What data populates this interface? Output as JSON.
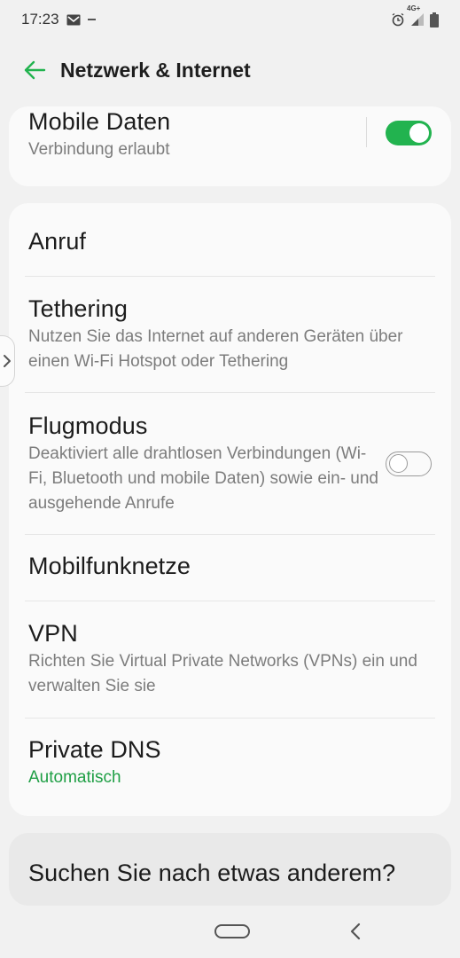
{
  "status": {
    "time": "17:23",
    "network": "4G+"
  },
  "header": {
    "title": "Netzwerk & Internet"
  },
  "mobile_data": {
    "title": "Mobile Daten",
    "subtitle": "Verbindung erlaubt",
    "enabled": true
  },
  "items": [
    {
      "title": "Anruf"
    },
    {
      "title": "Tethering",
      "subtitle": "Nutzen Sie das Internet auf anderen Geräten über einen Wi-Fi Hotspot oder Tethering"
    },
    {
      "title": "Flugmodus",
      "subtitle": "Deaktiviert alle drahtlosen Verbindungen (Wi-Fi, Bluetooth und mobile Daten) sowie ein- und ausgehende Anrufe",
      "enabled": false
    },
    {
      "title": "Mobilfunknetze"
    },
    {
      "title": "VPN",
      "subtitle": "Richten Sie Virtual Private Networks (VPNs) ein und verwalten Sie sie"
    },
    {
      "title": "Private DNS",
      "subtitle": "Automatisch"
    }
  ],
  "search_card": {
    "title": "Suchen Sie nach etwas anderem?"
  },
  "colors": {
    "accent": "#22b34f",
    "background": "#f1f1f1",
    "card": "#fafafa"
  }
}
